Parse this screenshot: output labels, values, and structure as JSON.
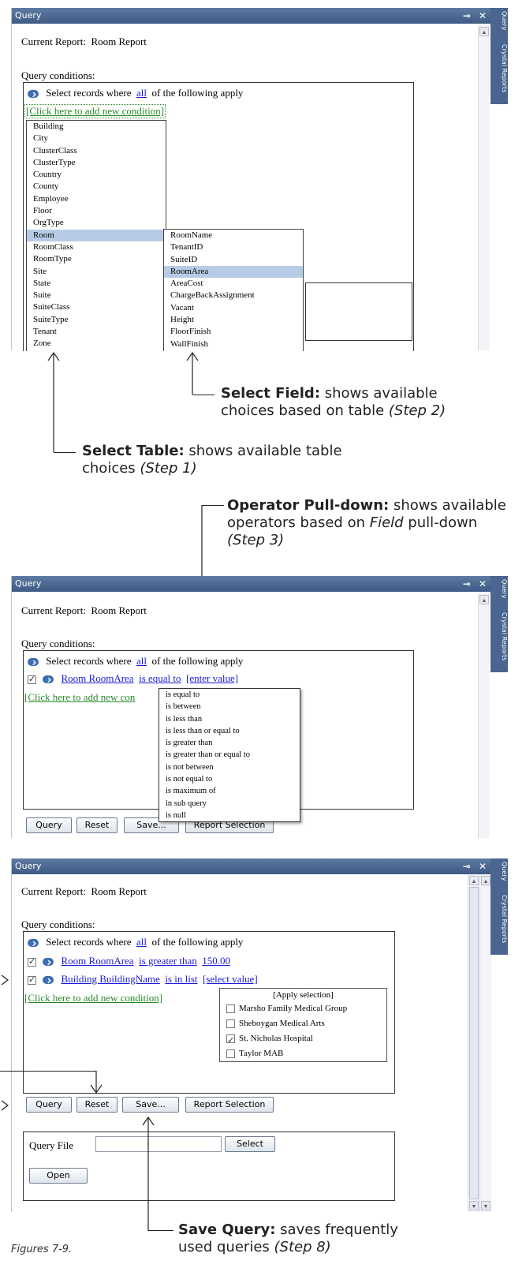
{
  "panel1": {
    "title": "Query",
    "side_tabs": [
      "Query",
      "Crystal Reports"
    ],
    "current_report_label": "Current Report:",
    "current_report_value": "Room Report",
    "query_conditions_label": "Query conditions:",
    "select_prefix": "Select records where",
    "select_scope": "all",
    "select_suffix": "of the following apply",
    "add_condition": "[Click here to add new condition]",
    "tables": [
      "Building",
      "City",
      "ClusterClass",
      "ClusterType",
      "Country",
      "County",
      "Employee",
      "Floor",
      "OrgType",
      "Room",
      "RoomClass",
      "RoomType",
      "Site",
      "State",
      "Suite",
      "SuiteClass",
      "SuiteType",
      "Tenant",
      "Zone"
    ],
    "selected_table": "Room",
    "fields": [
      "RoomName",
      "TenantID",
      "SuiteID",
      "RoomArea",
      "AreaCost",
      "ChargeBackAssignment",
      "Vacant",
      "Height",
      "FloorFinish",
      "WallFinish"
    ],
    "selected_field": "RoomArea"
  },
  "callouts": {
    "field": {
      "bold": "Select Field:",
      "text": " shows available",
      "line2": "choices based on table ",
      "step": "(Step 2)"
    },
    "table": {
      "bold": "Select Table:",
      "text": " shows available table",
      "line2": "choices ",
      "step": "(Step 1)"
    },
    "operator": {
      "bold": "Operator Pull-down:",
      "text": " shows available",
      "line2a": "operators based on ",
      "line2i": "Field",
      "line2b": " pull-down",
      "step": "(Step 3)"
    },
    "save": {
      "bold": "Save Query:",
      "text": " saves frequently",
      "line2": "used queries ",
      "step": "(Step 8)"
    }
  },
  "panel2": {
    "title": "Query",
    "side_tabs": [
      "Query",
      "Crystal Reports"
    ],
    "current_report_label": "Current Report:",
    "current_report_value": "Room Report",
    "query_conditions_label": "Query conditions:",
    "select_prefix": "Select records where",
    "select_scope": "all",
    "select_suffix": "of the following apply",
    "condition": {
      "field": "Room RoomArea",
      "operator": "is equal to",
      "value": "[enter value]"
    },
    "add_condition": "[Click here to add new con",
    "operators": [
      "is equal to",
      "is between",
      "is less than",
      "is less than or equal to",
      "is greater than",
      "is greater than or equal to",
      "is not between",
      "is not equal to",
      "is maximum of",
      "in sub query",
      "is null"
    ],
    "buttons": {
      "query": "Query",
      "reset": "Reset",
      "save": "Save...",
      "report": "Report Selection"
    }
  },
  "panel3": {
    "title": "Query",
    "side_tabs": [
      "Query",
      "Crystal Reports"
    ],
    "current_report_label": "Current Report:",
    "current_report_value": "Room Report",
    "query_conditions_label": "Query conditions:",
    "select_prefix": "Select records where",
    "select_scope": "all",
    "select_suffix": "of the following apply",
    "conditions": [
      {
        "field": "Room RoomArea",
        "operator": "is greater than",
        "value": "150.00"
      },
      {
        "field": "Building BuildingName",
        "operator": "is in list",
        "value": "[select value]"
      }
    ],
    "add_condition": "[Click here to add new condition]",
    "apply_selection": "[Apply selection]",
    "options": [
      {
        "label": "Marsho Family Medical Group",
        "checked": false
      },
      {
        "label": "Sheboygan Medical Arts",
        "checked": false
      },
      {
        "label": "St. Nicholas Hospital",
        "checked": true
      },
      {
        "label": "Taylor MAB",
        "checked": false
      }
    ],
    "buttons": {
      "query": "Query",
      "reset": "Reset",
      "save": "Save...",
      "report": "Report Selection"
    },
    "query_file_label": "Query File",
    "query_file_value": "",
    "select_button": "Select",
    "open_button": "Open"
  },
  "caption": "Figures 7-9."
}
